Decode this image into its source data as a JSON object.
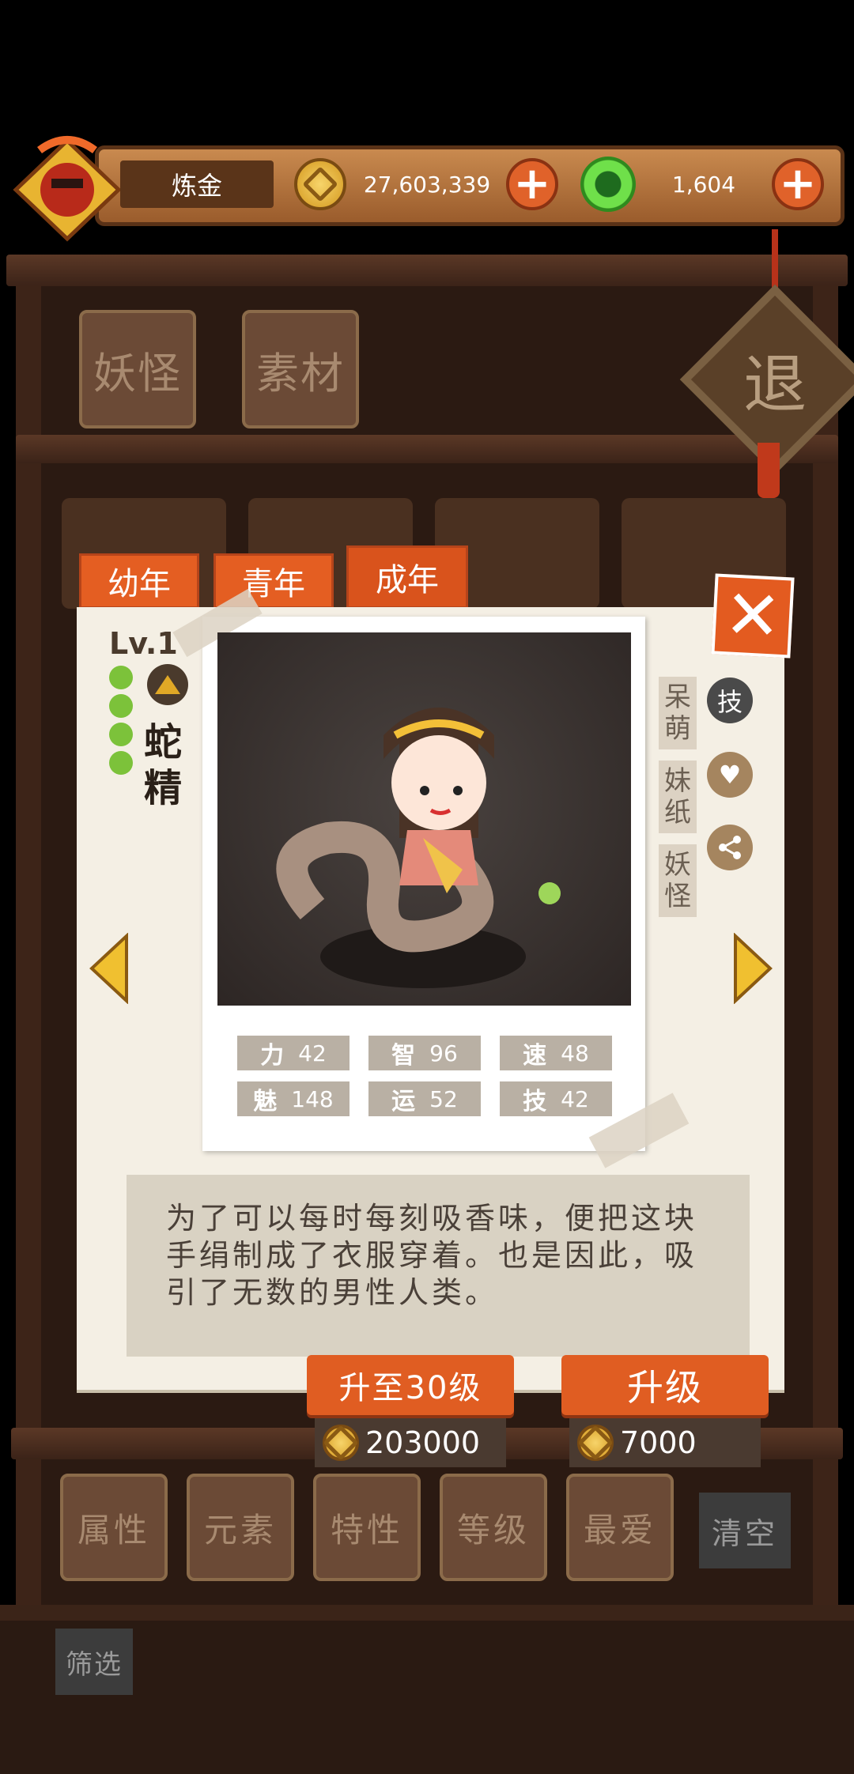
{
  "header": {
    "player_name": "炼金",
    "gold": "27,603,339",
    "gems": "1,604"
  },
  "top_tabs": [
    "妖怪",
    "素材"
  ],
  "exit_label": "退",
  "age_tabs": [
    "幼年",
    "青年",
    "成年"
  ],
  "monster": {
    "level": "Lv.1",
    "name_line1": "蛇",
    "name_line2": "精",
    "tags": [
      "呆萌",
      "妹纸",
      "妖怪"
    ],
    "skill_label": "技",
    "stats": [
      {
        "label": "力",
        "value": "42"
      },
      {
        "label": "智",
        "value": "96"
      },
      {
        "label": "速",
        "value": "48"
      },
      {
        "label": "魅",
        "value": "148"
      },
      {
        "label": "运",
        "value": "52"
      },
      {
        "label": "技",
        "value": "42"
      }
    ],
    "description": "为了可以每时每刻吸香味，便把这块手绢制成了衣服穿着。也是因此，吸引了无数的男性人类。"
  },
  "actions": {
    "upgrade30_label": "升至30级",
    "upgrade30_cost": "203000",
    "upgrade_label": "升级",
    "upgrade_cost": "7000"
  },
  "filter_tabs": [
    "属性",
    "元素",
    "特性",
    "等级",
    "最爱"
  ],
  "clear_label": "清空",
  "filter_label": "筛选",
  "colors": {
    "accent": "#e35b20",
    "paper": "#f4efe4",
    "wood": "#2b1a12"
  }
}
